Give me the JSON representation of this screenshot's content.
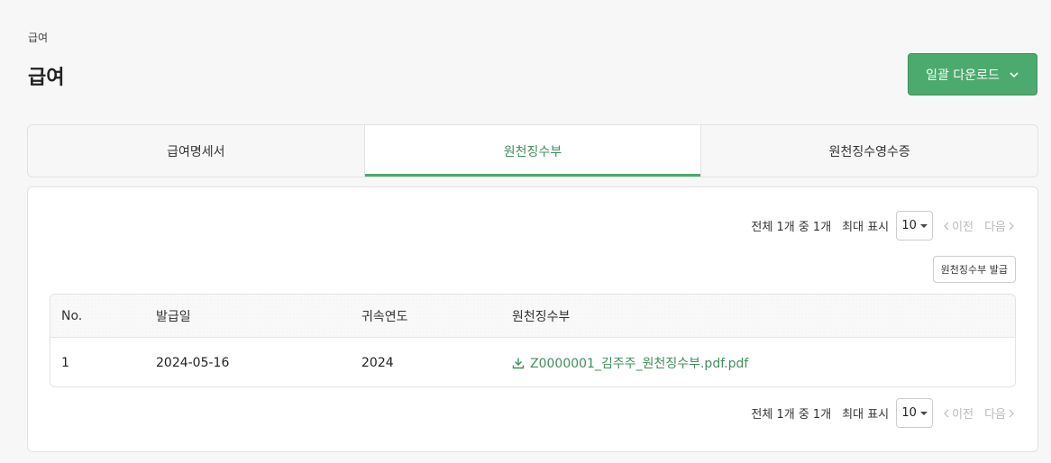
{
  "breadcrumb": "급여",
  "page_title": "급여",
  "download_button": {
    "label": "일괄 다운로드",
    "icon": "chevron-down-icon"
  },
  "tabs": [
    {
      "label": "급여명세서",
      "active": false
    },
    {
      "label": "원천징수부",
      "active": true
    },
    {
      "label": "원천징수영수증",
      "active": false
    }
  ],
  "pagination": {
    "total_text": "전체 1개 중 1개",
    "max_label": "최대 표시",
    "page_size": "10",
    "prev_label": "이전",
    "next_label": "다음"
  },
  "issue_button": "원천징수부 발급",
  "table": {
    "columns": [
      "No.",
      "발급일",
      "귀속연도",
      "원천징수부"
    ],
    "rows": [
      {
        "no": "1",
        "issue_date": "2024-05-16",
        "year": "2024",
        "file": "Z0000001_김주주_원천징수부.pdf.pdf"
      }
    ]
  },
  "colors": {
    "accent": "#4caa6e",
    "accent_text": "#3f8f5a"
  }
}
